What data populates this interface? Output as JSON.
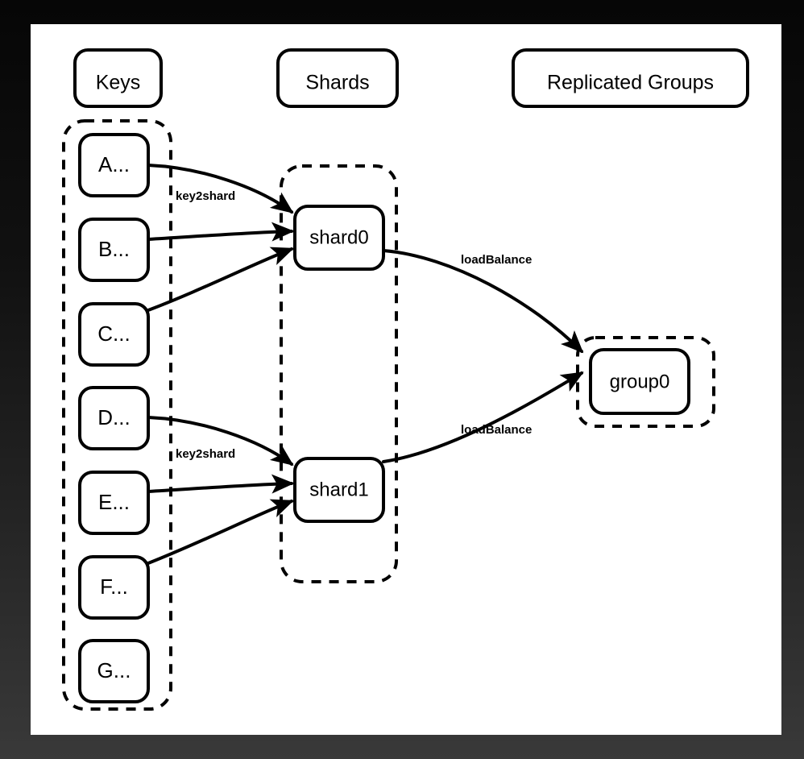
{
  "canvas": {
    "background_color": "#ffffff",
    "page_background_top": "#060606",
    "page_background_bottom": "#393939",
    "stroke_color": "#000000"
  },
  "headers": [
    {
      "id": "keys",
      "label": "Keys"
    },
    {
      "id": "shards",
      "label": "Shards"
    },
    {
      "id": "groups",
      "label": "Replicated Groups"
    }
  ],
  "keys": {
    "container_style": "dashed",
    "items": [
      {
        "id": "key-a",
        "label": "A..."
      },
      {
        "id": "key-b",
        "label": "B..."
      },
      {
        "id": "key-c",
        "label": "C..."
      },
      {
        "id": "key-d",
        "label": "D..."
      },
      {
        "id": "key-e",
        "label": "E..."
      },
      {
        "id": "key-f",
        "label": "F..."
      },
      {
        "id": "key-g",
        "label": "G..."
      }
    ]
  },
  "shards": {
    "container_style": "dashed",
    "items": [
      {
        "id": "shard0",
        "label": "shard0"
      },
      {
        "id": "shard1",
        "label": "shard1"
      }
    ]
  },
  "groups": {
    "container_style": "dashed",
    "items": [
      {
        "id": "group0",
        "label": "group0"
      }
    ]
  },
  "edge_labels": {
    "key2shard_top": "key2shard",
    "key2shard_bottom": "key2shard",
    "loadbalance_top": "loadBalance",
    "loadbalance_bottom": "loadBalance"
  },
  "edges": [
    {
      "id": "edge-a-shard0",
      "from": "A...",
      "to": "shard0",
      "label": "key2shard"
    },
    {
      "id": "edge-b-shard0",
      "from": "B...",
      "to": "shard0",
      "label": ""
    },
    {
      "id": "edge-c-shard0",
      "from": "C...",
      "to": "shard0",
      "label": ""
    },
    {
      "id": "edge-d-shard1",
      "from": "D...",
      "to": "shard1",
      "label": "key2shard"
    },
    {
      "id": "edge-e-shard1",
      "from": "E...",
      "to": "shard1",
      "label": ""
    },
    {
      "id": "edge-f-shard1",
      "from": "F...",
      "to": "shard1",
      "label": ""
    },
    {
      "id": "edge-shard0-group0",
      "from": "shard0",
      "to": "group0",
      "label": "loadBalance"
    },
    {
      "id": "edge-shard1-group0",
      "from": "shard1",
      "to": "group0",
      "label": "loadBalance"
    }
  ]
}
